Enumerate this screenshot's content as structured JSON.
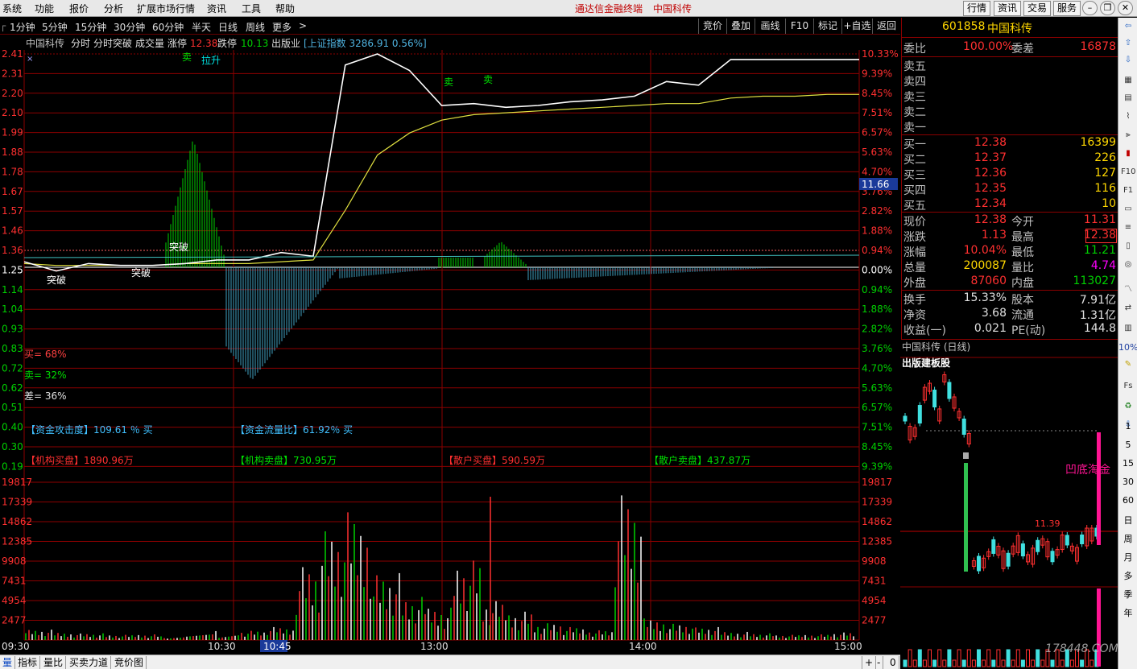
{
  "menu": {
    "items": [
      "系统",
      "功能",
      "报价",
      "分析",
      "扩展市场行情",
      "资讯",
      "工具",
      "帮助"
    ],
    "title": "通达信金融终端",
    "stock_title": "中国科传",
    "top_buttons": [
      "行情",
      "资讯",
      "交易",
      "服务"
    ]
  },
  "toolbar": {
    "periods": [
      "1分钟",
      "5分钟",
      "15分钟",
      "30分钟",
      "60分钟",
      "半天",
      "日线",
      "周线",
      "更多",
      ">"
    ],
    "tools": [
      "竞价",
      "叠加",
      "画线",
      "F10",
      "标记",
      "+自选",
      "返回"
    ]
  },
  "chart_header": {
    "stock": "中国科传",
    "items": [
      "分时",
      "分时突破",
      "成交量"
    ],
    "limit_up_label": "涨停",
    "limit_up": "12.38",
    "limit_down_label": "跌停",
    "limit_down": "10.13",
    "industry": "出版业",
    "index": "[上证指数 3286.91 0.56%]"
  },
  "chart_data": [
    {
      "type": "line",
      "name": "intraday-price",
      "y_ticks": [
        "2.41",
        "2.31",
        "2.20",
        "2.10",
        "1.99",
        "1.88",
        "1.78",
        "1.67",
        "1.57",
        "1.46",
        "1.36",
        "1.25",
        "1.14",
        "1.04",
        "0.93",
        "0.83",
        "0.72",
        "0.62",
        "0.51",
        "0.40",
        "0.30",
        "0.19"
      ],
      "y_right_ticks": [
        "10.33%",
        "9.39%",
        "8.45%",
        "7.51%",
        "6.57%",
        "5.63%",
        "4.70%",
        "3.76%",
        "2.82%",
        "1.88%",
        "0.94%",
        "0.00%",
        "0.94%",
        "1.88%",
        "2.82%",
        "3.76%",
        "4.70%",
        "5.63%",
        "6.57%",
        "7.51%",
        "8.45%",
        "9.39%"
      ],
      "cursor_value": "11.66",
      "x_ticks": [
        "09:30",
        "10:30",
        "10:45",
        "13:00",
        "14:00",
        "15:00"
      ],
      "price_line": [
        1.28,
        1.23,
        1.27,
        1.26,
        1.26,
        1.27,
        1.29,
        1.29,
        1.33,
        1.31,
        2.35,
        2.41,
        2.32,
        2.13,
        2.14,
        2.12,
        2.13,
        2.15,
        2.16,
        2.18,
        2.26,
        2.24,
        2.38,
        2.38,
        2.38,
        2.38,
        2.38
      ],
      "avg_line": [
        1.27,
        1.26,
        1.26,
        1.26,
        1.26,
        1.27,
        1.27,
        1.27,
        1.28,
        1.29,
        1.56,
        1.86,
        1.98,
        2.05,
        2.08,
        2.09,
        2.1,
        2.11,
        2.12,
        2.13,
        2.14,
        2.14,
        2.17,
        2.18,
        2.18,
        2.19,
        2.19
      ],
      "annotations": [
        "突破",
        "突破",
        "突破",
        "卖",
        "拉升",
        "卖",
        "卖"
      ],
      "flow_stats": {
        "buy": "买= 68%",
        "sell": "卖= 32%",
        "diff": "差= 36%"
      },
      "fund_stats": {
        "attack": "【资金攻击度】109.61 ％ 买",
        "flow_ratio": "【资金流量比】61.92％ 买",
        "inst_buy": "【机构买盘】1890.96万",
        "inst_sell": "【机构卖盘】730.95万",
        "retail_buy": "【散户买盘】590.59万",
        "retail_sell": "【散户卖盘】437.87万"
      }
    },
    {
      "type": "bar",
      "name": "volume",
      "y_ticks": [
        "19817",
        "17339",
        "14862",
        "12385",
        "9908",
        "7431",
        "4954",
        "2477"
      ],
      "values": [
        1200,
        900,
        800,
        600,
        700,
        500,
        600,
        900,
        1100,
        1500,
        9000,
        13000,
        14800,
        8000,
        5000,
        4000,
        9500,
        4500,
        3500,
        2000,
        1500,
        1200,
        17300,
        2500,
        2000,
        1500,
        1000,
        800,
        600,
        700,
        900
      ]
    }
  ],
  "quote": {
    "code": "601858",
    "name": "中国科传",
    "wei_bi_label": "委比",
    "wei_bi": "100.00%",
    "wei_cha_label": "委差",
    "wei_cha": "16878",
    "sell_levels": [
      {
        "label": "卖五",
        "price": "",
        "volume": ""
      },
      {
        "label": "卖四",
        "price": "",
        "volume": ""
      },
      {
        "label": "卖三",
        "price": "",
        "volume": ""
      },
      {
        "label": "卖二",
        "price": "",
        "volume": ""
      },
      {
        "label": "卖一",
        "price": "",
        "volume": ""
      }
    ],
    "buy_levels": [
      {
        "label": "买一",
        "price": "12.38",
        "volume": "16399"
      },
      {
        "label": "买二",
        "price": "12.37",
        "volume": "226"
      },
      {
        "label": "买三",
        "price": "12.36",
        "volume": "127"
      },
      {
        "label": "买四",
        "price": "12.35",
        "volume": "116"
      },
      {
        "label": "买五",
        "price": "12.34",
        "volume": "10"
      }
    ],
    "stats": [
      {
        "l1": "现价",
        "v1": "12.38",
        "l2": "今开",
        "v2": "11.31"
      },
      {
        "l1": "涨跌",
        "v1": "1.13",
        "l2": "最高",
        "v2": "12.38"
      },
      {
        "l1": "涨幅",
        "v1": "10.04%",
        "l2": "最低",
        "v2": "11.21"
      },
      {
        "l1": "总量",
        "v1": "200087",
        "l2": "量比",
        "v2": "4.74"
      },
      {
        "l1": "外盘",
        "v1": "87060",
        "l2": "内盘",
        "v2": "113027"
      }
    ],
    "fundamentals": [
      {
        "l1": "换手",
        "v1": "15.33%",
        "l2": "股本",
        "v2": "7.91亿"
      },
      {
        "l1": "净资",
        "v1": "3.68",
        "l2": "流通",
        "v2": "1.31亿"
      },
      {
        "l1": "收益(一)",
        "v1": "0.021",
        "l2": "PE(动)",
        "v2": "144.8"
      }
    ]
  },
  "mini_chart": {
    "title": "中国科传 (日线)",
    "subtitle": "出版建板股",
    "label_price": "11.39",
    "label_signal": "凹底淘金"
  },
  "right_tools": {
    "periods": [
      "1",
      "5",
      "15",
      "30",
      "60",
      "日",
      "周",
      "月",
      "多",
      "季",
      "年"
    ],
    "percent": "10%"
  },
  "bottom_tabs": [
    "量",
    "指标",
    "量比",
    "买卖力道",
    "竞价图"
  ],
  "bottom_right": [
    "+",
    "-",
    "0"
  ],
  "watermark": "178448.COM"
}
